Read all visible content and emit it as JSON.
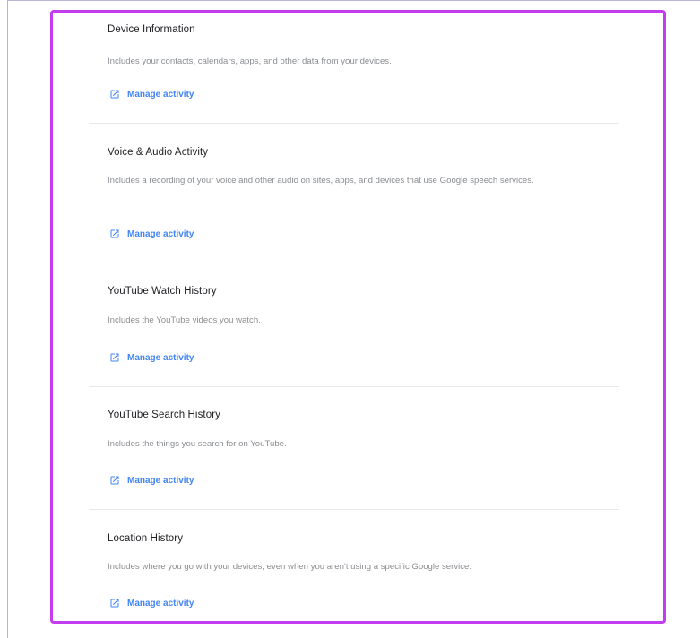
{
  "sections": [
    {
      "title": "Device Information",
      "description": "Includes your contacts, calendars, apps, and other data from your devices.",
      "link_label": "Manage activity"
    },
    {
      "title": "Voice & Audio Activity",
      "description": "Includes a recording of your voice and other audio on sites, apps, and devices that use Google speech services.",
      "link_label": "Manage activity"
    },
    {
      "title": "YouTube Watch History",
      "description": "Includes the YouTube videos you watch.",
      "link_label": "Manage activity"
    },
    {
      "title": "YouTube Search History",
      "description": "Includes the things you search for on YouTube.",
      "link_label": "Manage activity"
    },
    {
      "title": "Location History",
      "description": "Includes where you go with your devices, even when you aren't using a specific Google service.",
      "link_label": "Manage activity"
    }
  ],
  "icons": {
    "manage_link": "open-in-new-icon"
  },
  "colors": {
    "highlight_border": "#c43cf0",
    "link": "#4285f4",
    "title": "#202124",
    "description": "#8a8d91",
    "divider": "#e8e8ec"
  }
}
